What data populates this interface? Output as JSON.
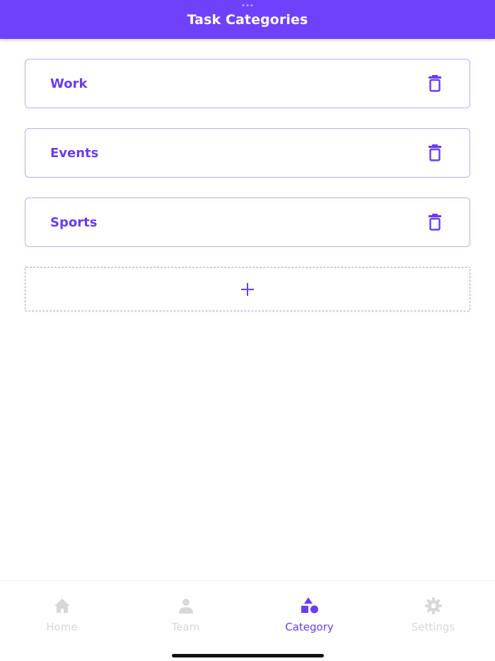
{
  "header": {
    "title": "Task Categories"
  },
  "categories": [
    {
      "label": "Work"
    },
    {
      "label": "Events"
    },
    {
      "label": "Sports"
    }
  ],
  "icons": {
    "delete": "trash-icon",
    "add": "plus-icon"
  },
  "tabs": [
    {
      "label": "Home",
      "icon": "home-icon",
      "active": false
    },
    {
      "label": "Team",
      "icon": "person-icon",
      "active": false
    },
    {
      "label": "Category",
      "icon": "shapes-icon",
      "active": true
    },
    {
      "label": "Settings",
      "icon": "gear-icon",
      "active": false
    }
  ],
  "colors": {
    "accent": "#7041fa",
    "text_accent": "#6a3df0",
    "inactive": "#d8d8d8",
    "card_border": "#b6aff0"
  }
}
